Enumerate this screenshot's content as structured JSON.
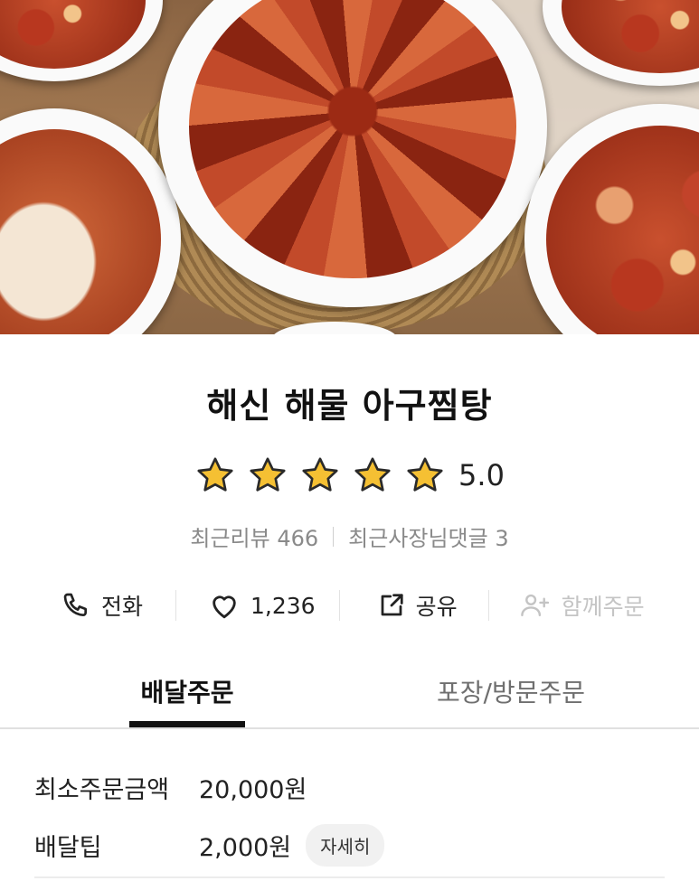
{
  "store": {
    "name": "해신 해물 아구찜탕",
    "rating": "5.0",
    "star_count": 5,
    "star_color": "#f5c033",
    "recent_reviews_label": "최근리뷰",
    "recent_reviews_count": "466",
    "owner_replies_label": "최근사장님댓글",
    "owner_replies_count": "3"
  },
  "actions": {
    "call": {
      "icon": "phone-icon",
      "label": "전화"
    },
    "like": {
      "icon": "heart-icon",
      "label": "1,236"
    },
    "share": {
      "icon": "share-icon",
      "label": "공유"
    },
    "group_order": {
      "icon": "add-person-icon",
      "label": "함께주문"
    }
  },
  "tabs": [
    {
      "label": "배달주문",
      "active": true
    },
    {
      "label": "포장/방문주문",
      "active": false
    }
  ],
  "delivery": {
    "min_order_label": "최소주문금액",
    "min_order_value": "20,000원",
    "tip_label": "배달팁",
    "tip_value": "2,000원",
    "detail_button": "자세히"
  }
}
